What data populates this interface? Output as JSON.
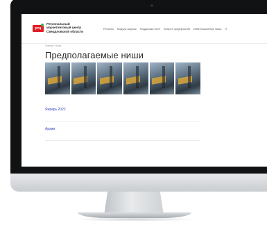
{
  "header": {
    "logo_text": "ртц",
    "org_lines": [
      "Региональный",
      "маркетинговый центр",
      "Свердловской области"
    ],
    "nav": [
      "Регионы",
      "Модуль закупок",
      "Поддержка МСП",
      "Каталог предприятий",
      "Инвестиционные ниши",
      "П"
    ]
  },
  "breadcrumb": "Главная / Ниши",
  "page_title": "Предполагаемые ниши",
  "banner": {
    "panels": 6
  },
  "links": [
    {
      "label": "Январь 2022"
    },
    {
      "label": "Архив"
    }
  ],
  "colors": {
    "brand_red": "#e01e25",
    "brand_green": "#2db84b",
    "link": "#2f3fbf"
  }
}
